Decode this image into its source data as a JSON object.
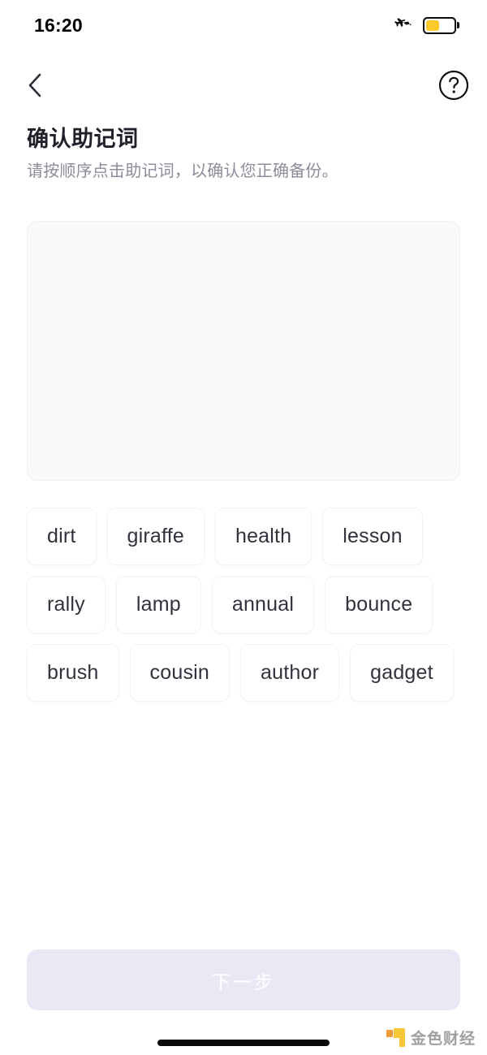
{
  "status_bar": {
    "time": "16:20",
    "airplane_icon": "airplane-mode-icon",
    "battery_icon": "battery-low-power-icon",
    "battery_level_percent": 43,
    "battery_color": "#fdc82a"
  },
  "nav": {
    "back_icon": "chevron-left-icon",
    "help_icon": "question-mark-circle-icon"
  },
  "header": {
    "title": "确认助记词",
    "subtitle": "请按顺序点击助记词，以确认您正确备份。",
    "title_color": "#1f2029",
    "subtitle_color": "#8c8c9a"
  },
  "answer_box": {
    "selected_words": [],
    "background_color": "#fafafb",
    "border_color": "#f0f0f2"
  },
  "word_pool": {
    "words": [
      "dirt",
      "giraffe",
      "health",
      "lesson",
      "rally",
      "lamp",
      "annual",
      "bounce",
      "brush",
      "cousin",
      "author",
      "gadget"
    ],
    "chip_text_color": "#31323c",
    "chip_background": "#ffffff"
  },
  "footer": {
    "next_label": "下一步",
    "next_disabled": true,
    "next_background": "#e9e9f6",
    "next_text_color": "#ffffff"
  },
  "watermark": {
    "text": "金色财经",
    "mark_color_primary": "#f7c52d",
    "mark_color_secondary": "#f0962b"
  }
}
